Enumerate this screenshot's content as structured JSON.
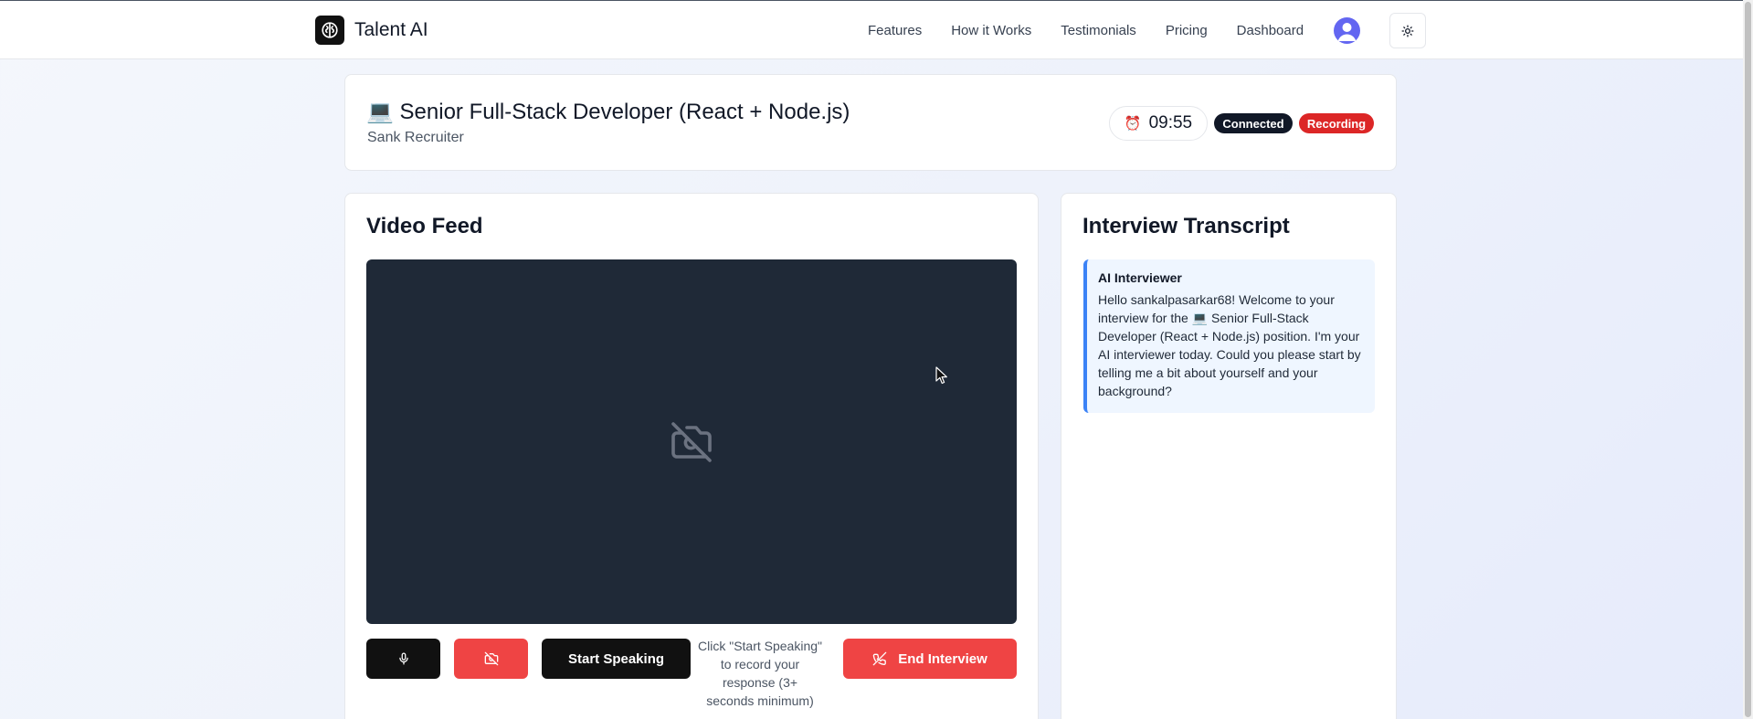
{
  "app": {
    "name": "Talent AI"
  },
  "nav": {
    "links": [
      "Features",
      "How it Works",
      "Testimonials",
      "Pricing",
      "Dashboard"
    ],
    "icons": {
      "logo": "brain-icon",
      "avatar": "user-avatar-icon",
      "theme": "sun-icon"
    }
  },
  "interview": {
    "title": "💻 Senior Full-Stack Developer (React + Node.js)",
    "company": "Sank Recruiter",
    "timer": "09:55",
    "status_connected": "Connected",
    "status_recording": "Recording"
  },
  "video": {
    "title": "Video Feed",
    "placeholder_icon": "camera-off-icon",
    "controls": {
      "mic_icon": "microphone-icon",
      "camera_icon": "camera-off-icon",
      "start_speaking": "Start Speaking",
      "hint": "Click \"Start Speaking\" to record your response (3+ seconds minimum)",
      "end_interview": "End Interview",
      "end_icon": "phone-off-icon"
    }
  },
  "transcript": {
    "title": "Interview Transcript",
    "messages": [
      {
        "author": "AI Interviewer",
        "text": "Hello sankalpasarkar68! Welcome to your interview for the 💻 Senior Full-Stack Developer (React + Node.js) position. I'm your AI interviewer today. Could you please start by telling me a bit about yourself and your background?"
      }
    ]
  },
  "colors": {
    "accent_dark": "#111111",
    "danger": "#ef4444",
    "recording": "#dc2626",
    "transcript_border": "#3b82f6",
    "video_bg": "#1f2937"
  }
}
